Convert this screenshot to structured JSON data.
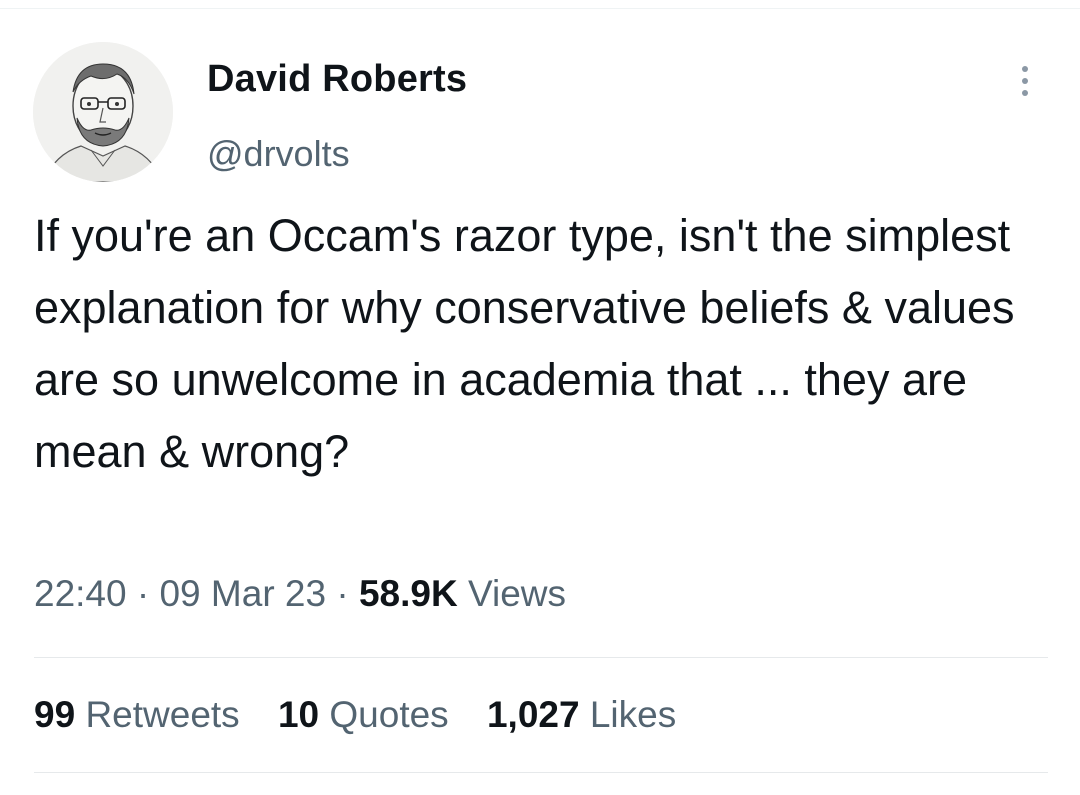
{
  "author": {
    "display_name": "David Roberts",
    "handle": "@drvolts",
    "avatar": "sketch-portrait-avatar"
  },
  "more_menu_icon": "vertical-ellipsis-icon",
  "tweet": {
    "text": "If you're an Occam's razor type, isn't the simplest explanation for why conservative beliefs & values are so unwelcome in academia that ... they are mean & wrong?"
  },
  "meta": {
    "time": "22:40",
    "separator": "·",
    "date": "09 Mar 23",
    "views_count": "58.9K",
    "views_label": "Views"
  },
  "stats": [
    {
      "count": "99",
      "label": "Retweets"
    },
    {
      "count": "10",
      "label": "Quotes"
    },
    {
      "count": "1,027",
      "label": "Likes"
    }
  ],
  "colors": {
    "text": "#0f1419",
    "secondary": "#536471",
    "divider": "#e6e9eb"
  }
}
